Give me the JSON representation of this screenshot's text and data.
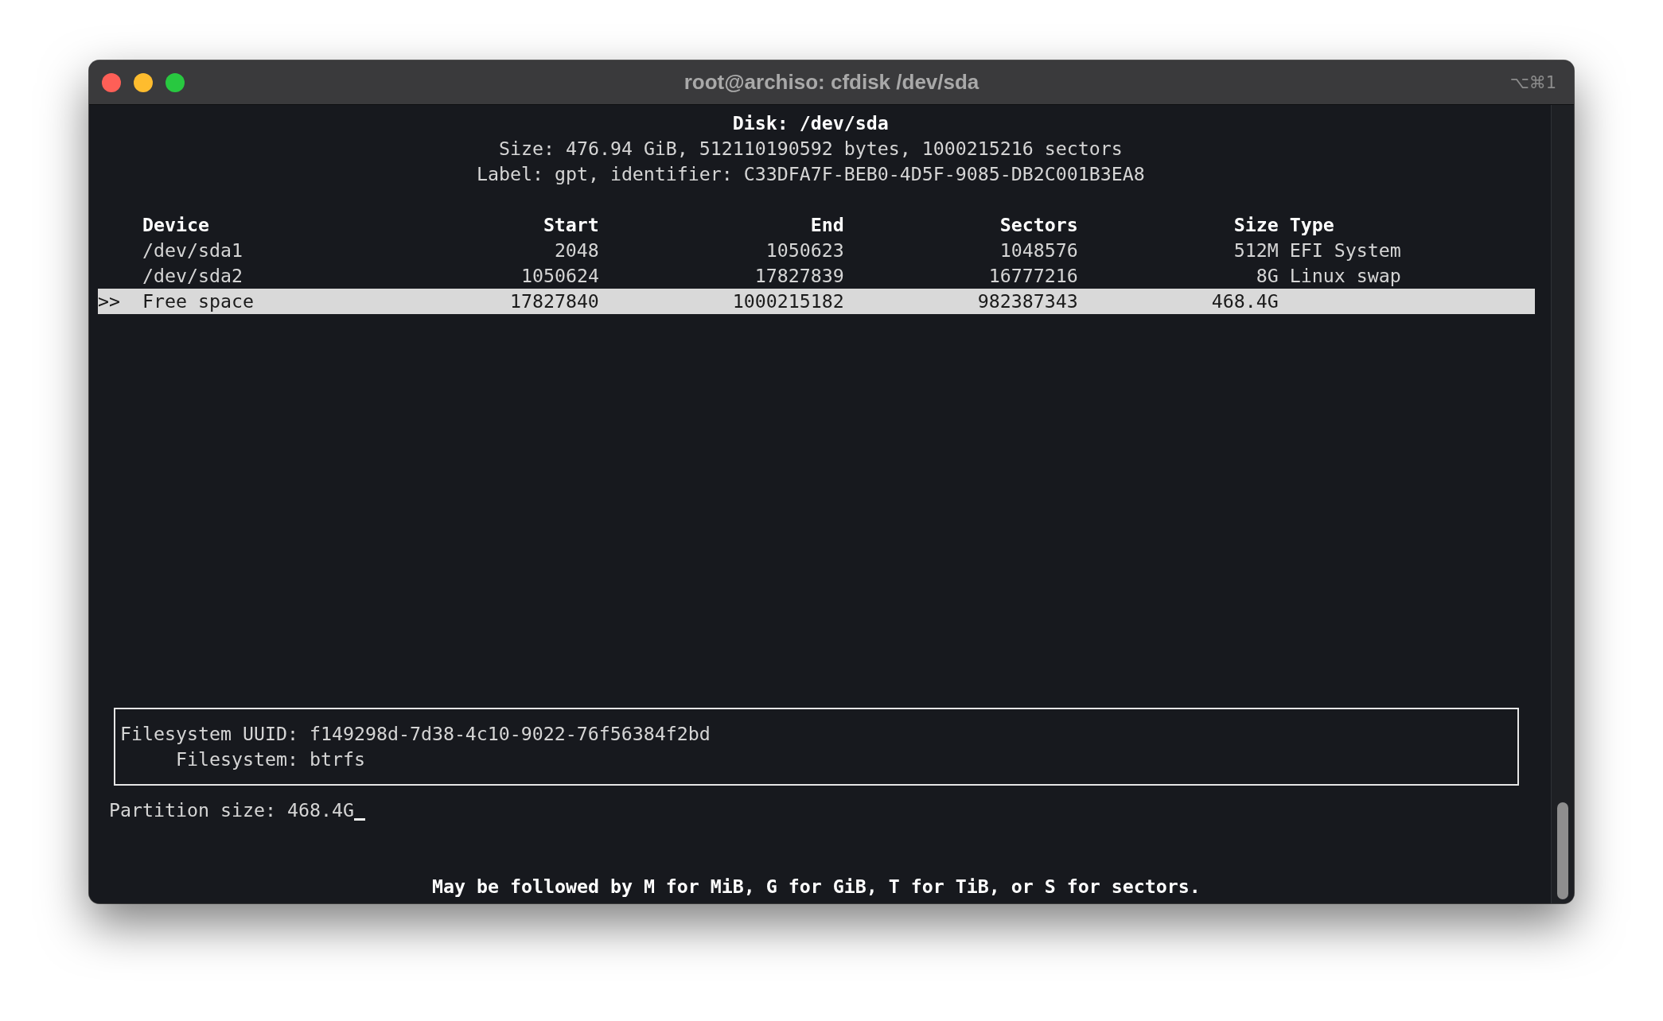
{
  "window": {
    "title": "root@archiso: cfdisk /dev/sda",
    "shortcut": "⌥⌘1"
  },
  "disk": {
    "heading": "Disk: /dev/sda",
    "size": "Size: 476.94 GiB, 512110190592 bytes, 1000215216 sectors",
    "label": "Label: gpt, identifier: C33DFA7F-BEB0-4D5F-9085-DB2C001B3EA8"
  },
  "table": {
    "cursor": ">>",
    "columns": [
      "Device",
      "Start",
      "End",
      "Sectors",
      "Size",
      "Type"
    ],
    "rows": [
      {
        "device": "/dev/sda1",
        "start": "2048",
        "end": "1050623",
        "sectors": "1048576",
        "size": "512M",
        "type": "EFI System",
        "selected": false
      },
      {
        "device": "/dev/sda2",
        "start": "1050624",
        "end": "17827839",
        "sectors": "16777216",
        "size": "8G",
        "type": "Linux swap",
        "selected": false
      },
      {
        "device": "Free space",
        "start": "17827840",
        "end": "1000215182",
        "sectors": "982387343",
        "size": "468.4G",
        "selected": true
      }
    ]
  },
  "info_box": {
    "lines": [
      {
        "label": "Filesystem UUID:",
        "value": "f149298d-7d38-4c10-9022-76f56384f2bd"
      },
      {
        "label": "Filesystem:",
        "value": "btrfs"
      }
    ]
  },
  "prompt": {
    "label": "Partition size:",
    "value": "468.4G"
  },
  "hint": "May be followed by M for MiB, G for GiB, T for TiB, or S for sectors."
}
